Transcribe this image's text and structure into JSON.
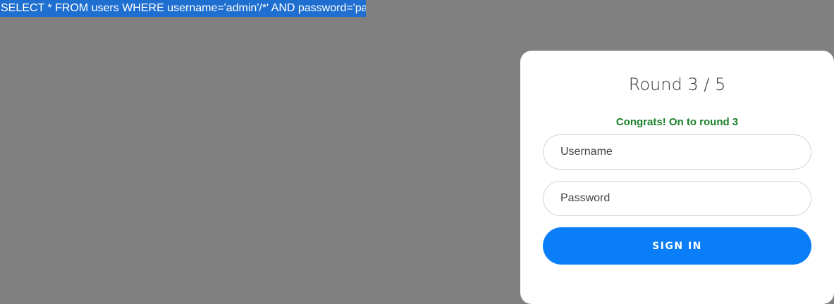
{
  "query": {
    "text": "SELECT * FROM users WHERE username='admin'/*' AND password='pass'"
  },
  "login_card": {
    "round_title": "Round 3 / 5",
    "status_message": "Congrats! On to round 3",
    "username_placeholder": "Username",
    "password_placeholder": "Password",
    "signin_label": "SIGN IN"
  },
  "colors": {
    "background": "#808080",
    "selection": "#1f6fd0",
    "success_text": "#1a7f2a",
    "primary_button": "#0a7df8"
  }
}
